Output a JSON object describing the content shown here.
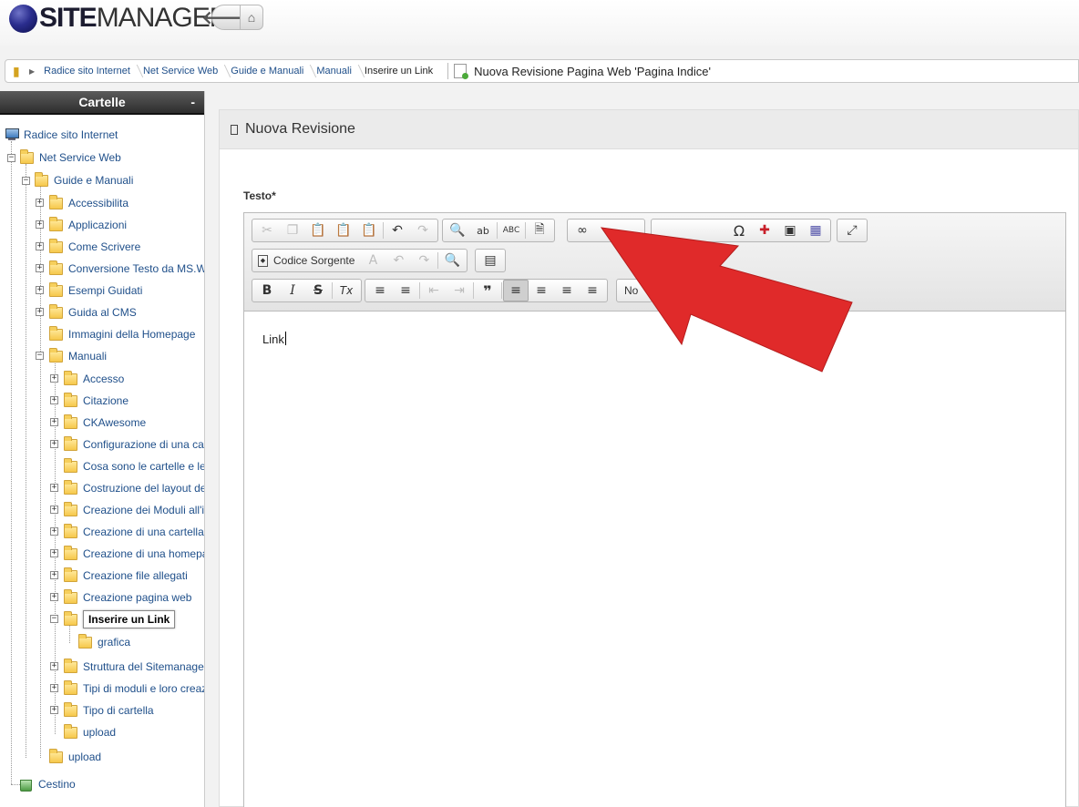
{
  "header": {
    "logo_bold": "SITE",
    "logo_light": "MANAGER",
    "back_label": "🡐",
    "home_label": "⌂"
  },
  "breadcrumb": {
    "items": [
      "Radice sito Internet",
      "Net Service Web",
      "Guide e Manuali",
      "Manuali",
      "Inserire un Link"
    ],
    "page_title": "Nuova Revisione Pagina Web 'Pagina Indice'"
  },
  "sidebar": {
    "title": "Cartelle",
    "collapse": "-",
    "root": "Radice sito Internet",
    "nodes": [
      "Net Service Web",
      "Guide e Manuali",
      "Accessibilita",
      "Applicazioni",
      "Come Scrivere",
      "Conversione Testo da MS.Word",
      "Esempi Guidati",
      "Guida al CMS",
      "Immagini della Homepage",
      "Manuali",
      "Accesso",
      "Citazione",
      "CKAwesome",
      "Configurazione di una cartella",
      "Cosa sono le cartelle e le pagine",
      "Costruzione del layout della pagina",
      "Creazione dei Moduli all'interno",
      "Creazione di una cartella",
      "Creazione di una homepage",
      "Creazione file allegati",
      "Creazione pagina web",
      "Inserire un Link",
      "grafica",
      "Struttura del Sitemanager",
      "Tipi di moduli e loro creazione",
      "Tipo di cartella",
      "upload",
      "upload"
    ],
    "trash": "Cestino"
  },
  "panel": {
    "title": "Nuova Revisione",
    "field_label": "Testo*"
  },
  "editor": {
    "source_label": "Codice Sorgente",
    "format_label": "No",
    "content": "Link",
    "icons": {
      "cut": "✂",
      "copy": "❐",
      "paste": "📋",
      "paste_text": "📋",
      "paste_word": "📋",
      "undo": "↶",
      "redo": "↷",
      "find": "🔍",
      "replace": "ab",
      "spell": "ABC",
      "template": "🗎",
      "link": "∞",
      "omega": "Ω",
      "plus": "✚",
      "flash": "▣",
      "grid": "▦",
      "maximize": "⤢",
      "abc": "A",
      "undo2": "↶",
      "redo2": "↷",
      "preview": "🔍",
      "block": "▤",
      "bold": "B",
      "italic": "I",
      "strike": "S",
      "remove_format": "Tx",
      "numbered": "≡",
      "bulleted": "≡",
      "outdent": "⇤",
      "indent": "⇥",
      "quote": "❞",
      "left": "≡",
      "center": "≡",
      "right": "≡",
      "justify": "≡"
    }
  },
  "colors": {
    "link": "#1f4f8a",
    "sidebar_header": "#2e2e2e",
    "arrow": "#e02a2a"
  }
}
